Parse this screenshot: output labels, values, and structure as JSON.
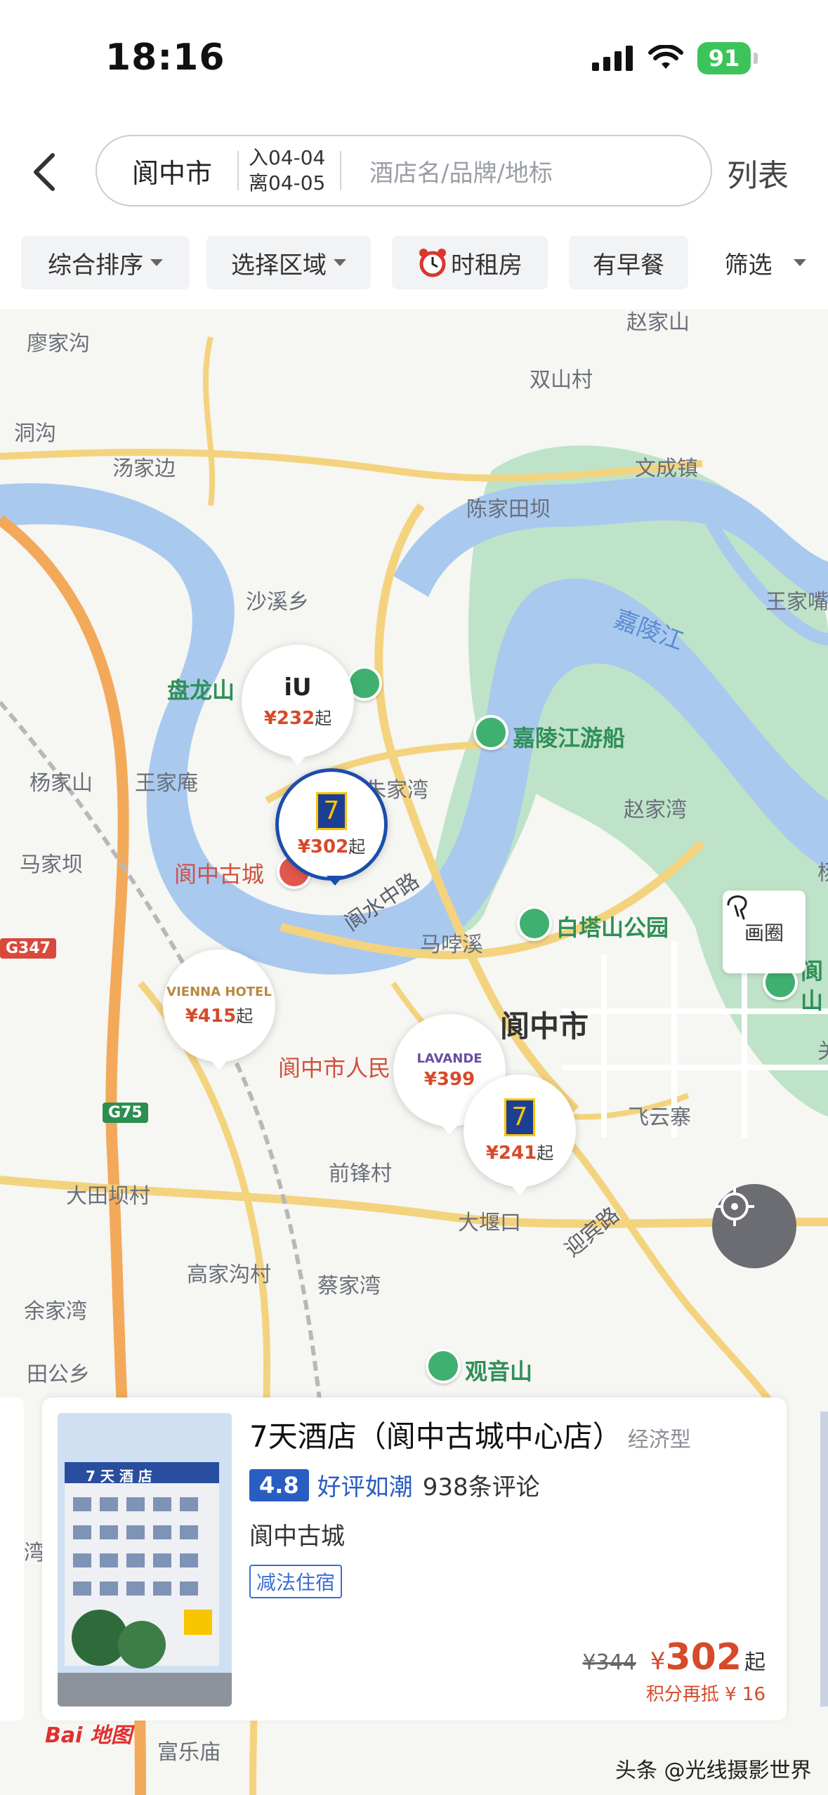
{
  "status_bar": {
    "time": "18:16",
    "battery": "91"
  },
  "header": {
    "city": "阆中市",
    "checkin": "入04-04",
    "checkout": "离04-05",
    "keyword_placeholder": "酒店名/品牌/地标",
    "list_label": "列表"
  },
  "filters": [
    {
      "label": "综合排序"
    },
    {
      "label": "选择区域"
    },
    {
      "label": "时租房"
    },
    {
      "label": "有早餐"
    },
    {
      "label": "筛选"
    }
  ],
  "map": {
    "labels": {
      "liaojiagou": "廖家沟",
      "zhaojiashan": "赵家山",
      "shuangshancun": "双山村",
      "donggou": "洞沟",
      "tangjiabian": "汤家边",
      "wenchengzhen": "文成镇",
      "chenjiatianba": "陈家田坝",
      "shaxixiang": "沙溪乡",
      "wangjiazui": "王家嘴",
      "jialingjiang": "嘉陵江",
      "panlongshan": "盘龙山",
      "jialingjiang_youchuan": "嘉陵江游船",
      "yangjiashan": "杨家山",
      "wangjiaan": "王家庵",
      "zhujiawan": "朱家湾",
      "zhaojiawan": "赵家湾",
      "majiaba": "马家坝",
      "langzhong_gucheng": "阆中古城",
      "langshuizhonglu": "阆水中路",
      "baitashan": "白塔山公园",
      "maxixi": "马哱溪",
      "langzhongshi": "阆中市",
      "langzhong_renmin": "阆中市人民",
      "feiyunzhai": "飞云寨",
      "qianfengcun": "前锋村",
      "datianba": "大田坝村",
      "dayankou": "大堰口",
      "yingbinlu": "迎宾路",
      "gaojiagou": "高家沟村",
      "caijiawan": "蔡家湾",
      "yujiawan": "余家湾",
      "guanyinshan": "观音山",
      "tiangongxiang": "田公乡",
      "fulemiao": "富乐庙",
      "g347": "G347",
      "g75": "G75",
      "wan": "湾",
      "right_lang": "阆",
      "right_shan": "山",
      "right_yang": "杨",
      "right_guan": "关"
    },
    "pins": [
      {
        "brand": "IU酒店",
        "price": "232",
        "suffix": "起"
      },
      {
        "brand": "7天酒店",
        "price": "302",
        "suffix": "起",
        "selected": true
      },
      {
        "brand": "VIENNA HOTEL 维也纳酒店",
        "price": "415",
        "suffix": "起"
      },
      {
        "brand": "LAVANDE 麗枫酒店",
        "price": "399",
        "suffix": ""
      },
      {
        "brand": "7天酒店",
        "price": "241",
        "suffix": "起"
      }
    ],
    "draw_label": "画圈",
    "yen": "¥"
  },
  "card": {
    "name": "7天酒店（阆中古城中心店）",
    "type": "经济型",
    "score": "4.8",
    "score_text": "好评如潮",
    "reviews": "938条评论",
    "area": "阆中古城",
    "tag": "减法住宿",
    "original_price": "¥344",
    "yen": "¥",
    "price": "302",
    "price_suffix": "起",
    "points": "积分再抵 ¥ 16",
    "photo_sign": "7 天 酒 店"
  },
  "footer": {
    "baidu": "Bai 地图",
    "watermark": "头条 @光线摄影世界"
  },
  "colors": {
    "water": "#a9c9ef",
    "park": "#b9e0c4",
    "road": "#f4d37e",
    "highway": "#f3a95a",
    "accent": "#2a5dc1",
    "price": "#d64a2a"
  }
}
